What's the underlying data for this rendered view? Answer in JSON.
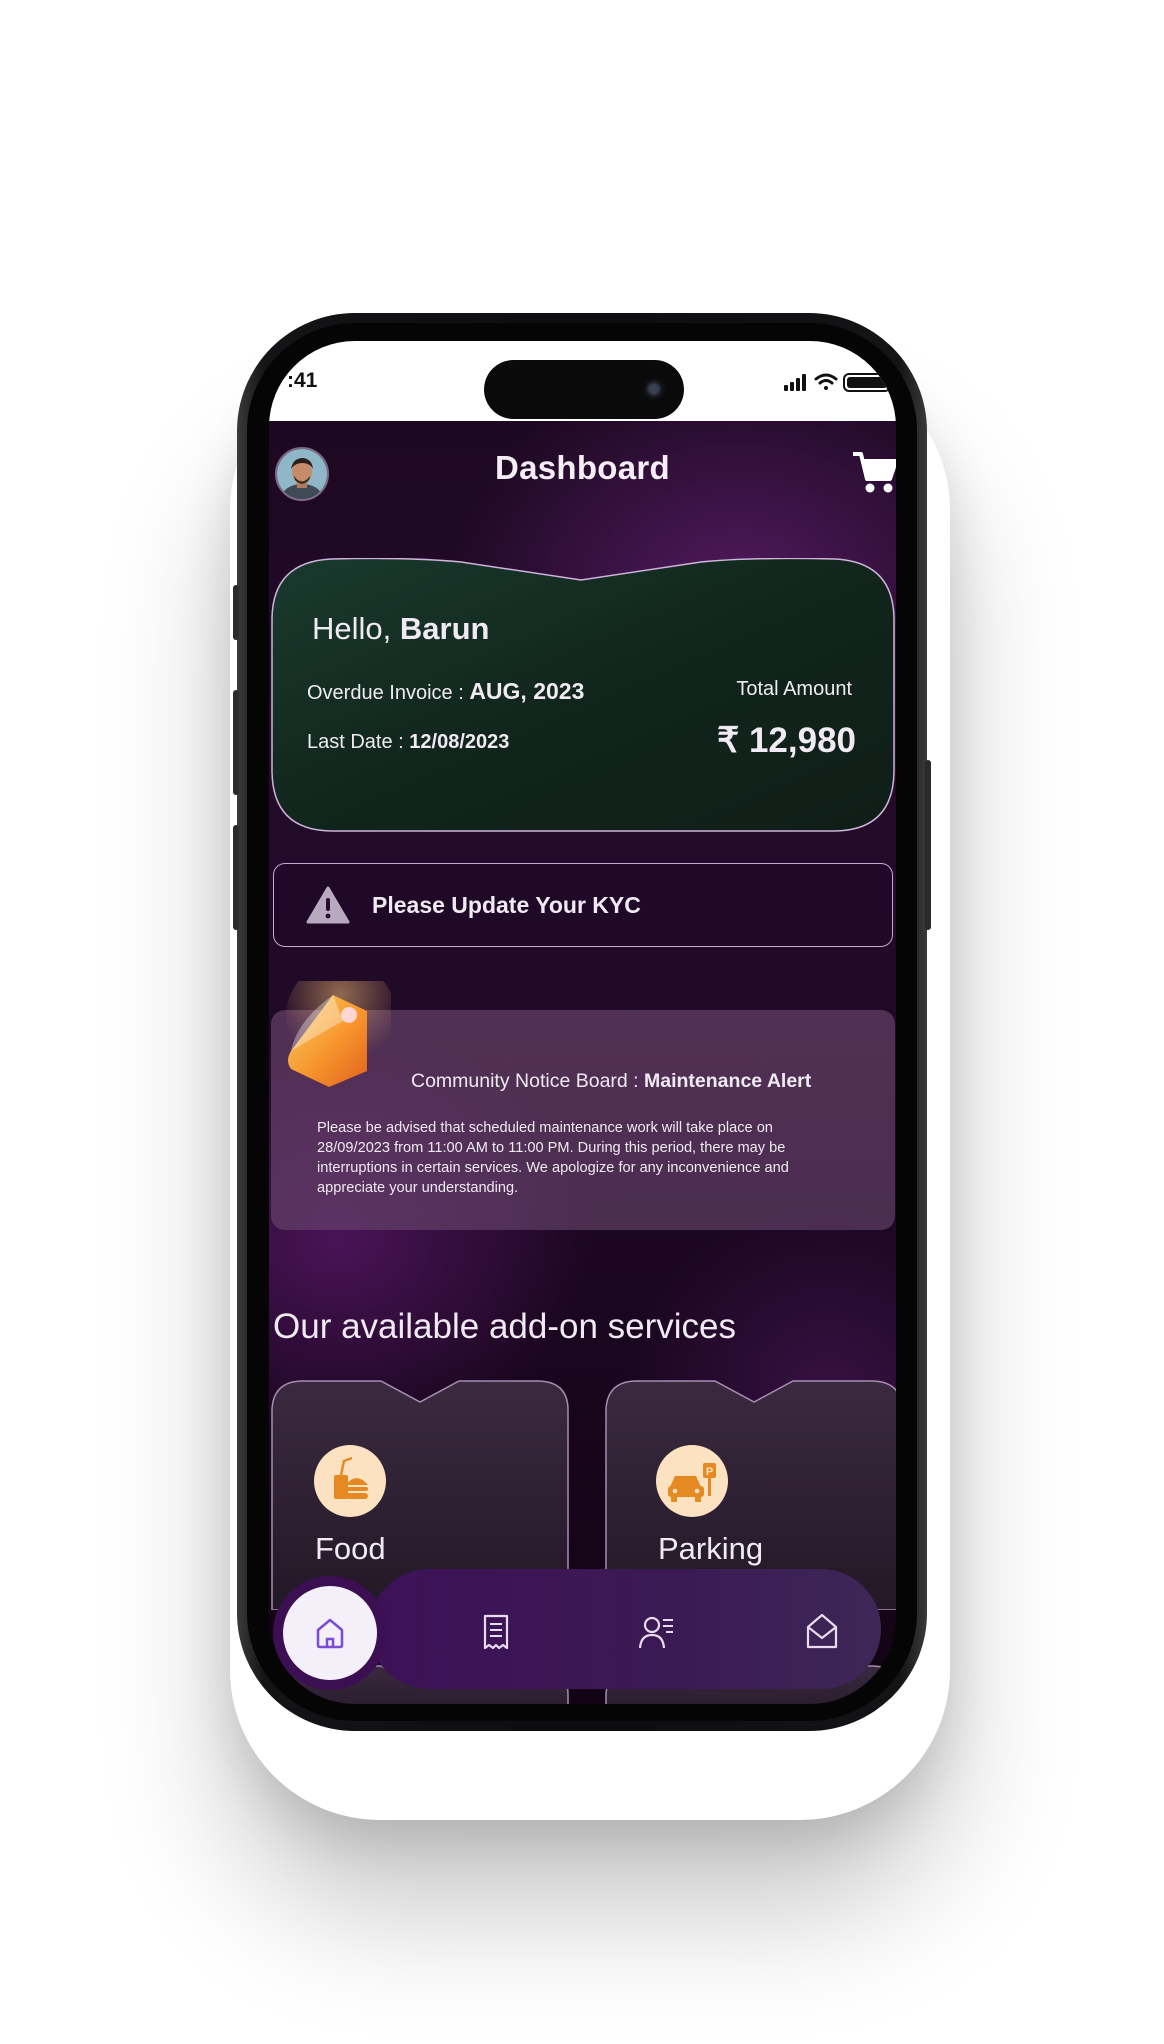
{
  "status_bar": {
    "time": ":41"
  },
  "header": {
    "title": "Dashboard"
  },
  "invoice_card": {
    "greeting": "Hello,",
    "name": "Barun",
    "overdue_label": "Overdue Invoice :",
    "overdue_value": "AUG, 2023",
    "last_date_label": "Last Date :",
    "last_date_value": "12/08/2023",
    "total_label": "Total Amount",
    "total_value": "₹ 12,980"
  },
  "kyc_banner": {
    "text": "Please Update Your KYC"
  },
  "notice": {
    "label": "Community Notice Board :",
    "title": "Maintenance Alert",
    "body_lines": [
      "Please be advised that scheduled maintenance work will take place on",
      "28/09/2023 from 11:00 AM to 11:00 PM. During this period, there may be",
      "interruptions in certain services. We apologize for any inconvenience and",
      "appreciate your understanding."
    ]
  },
  "services": {
    "heading": "Our available add-on services",
    "items": [
      {
        "label": "Food",
        "icon": "food-icon"
      },
      {
        "label": "Parking",
        "icon": "parking-icon"
      }
    ]
  },
  "bottom_nav": {
    "items": [
      "home-icon",
      "receipt-icon",
      "profile-list-icon",
      "mail-icon"
    ],
    "active": "home-icon"
  },
  "colors": {
    "card_bg": "#13261c",
    "accent": "#e58a22",
    "nav_bg": "#3d1157",
    "text": "#f0eaf2"
  }
}
